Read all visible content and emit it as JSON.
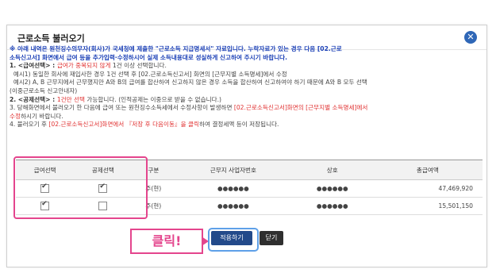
{
  "dialog": {
    "title": "근로소득 불러오기"
  },
  "notice": {
    "line1": "※ 아래 내역은 원천징수의무자(회사)가 국세청에 제출한 \"근로소득 지급명세서\" 자료입니다. 누락자료가 있는 경우 다음 [02.근로",
    "line2": "소득신고서] 화면에서 급여 등을 추가입력·수정하시어 실제 소득내용대로 성실하게 신고하여 주시기 바랍니다.",
    "line3_prefix": "1. <급여선택> : ",
    "line3_red": "급여가 중복되지 않게",
    "line3_suffix": " 1건 이상 선택합니다.",
    "line4": "예시1) 동일한 회사에 재입사한 경우 1건 선택 후 [02.근로소득신고서] 화면의 [근무지별 소득명세]에서 수정",
    "line5": "예시2) A, B 근무지에서 근무했지만 A와 B의 급여를 합산하여 신고하지 않은 경우 소득을 합산하여 신고하여야 하기 때문에 A와 B 모두 선택",
    "line6": "(이중근로소득 신고안내자)",
    "line7_prefix": "2. <공제선택> : ",
    "line7_red": "1건만 선택",
    "line7_suffix": " 가능합니다. (인적공제는 이중으로 받을 수 없습니다.)",
    "line8_prefix": "3. 당해화면에서 불러오기 한 다음에 급여 또는 원천징수소득세에서 수정사항이 발생하면 ",
    "line8_red": "[02.근로소득신고서]화면의 [근무지별 소득명세]에서",
    "line9_red": "수정",
    "line9_suffix": "하시기 바랍니다.",
    "line10_prefix": "4. 불러오기 후 ",
    "line10_red": "[02.근로소득신고서]화면에서 『저장 후 다음이동』을 클릭",
    "line10_suffix": "하여 결정세액 등이 저장됩니다."
  },
  "table": {
    "headers": [
      "급여선택",
      "공제선택",
      "구분",
      "근무지 사업자번호",
      "상호",
      "총급여액"
    ],
    "rows": [
      {
        "salary_checked": true,
        "deduction_checked": true,
        "type": "주(현)",
        "bizno": "●●●●●●",
        "name": "●●●●●●",
        "total": "47,469,920"
      },
      {
        "salary_checked": true,
        "deduction_checked": false,
        "type": "주(현)",
        "bizno": "●●●●●●",
        "name": "●●●●●●",
        "total": "15,501,150"
      }
    ]
  },
  "buttons": {
    "apply": "적용하기",
    "close": "닫기"
  },
  "callout": "클릭!",
  "colors": {
    "accent_pink": "#e4458d",
    "apply_blue": "#234a8a",
    "notice_blue": "#1a3fb6",
    "notice_red": "#e03030"
  }
}
